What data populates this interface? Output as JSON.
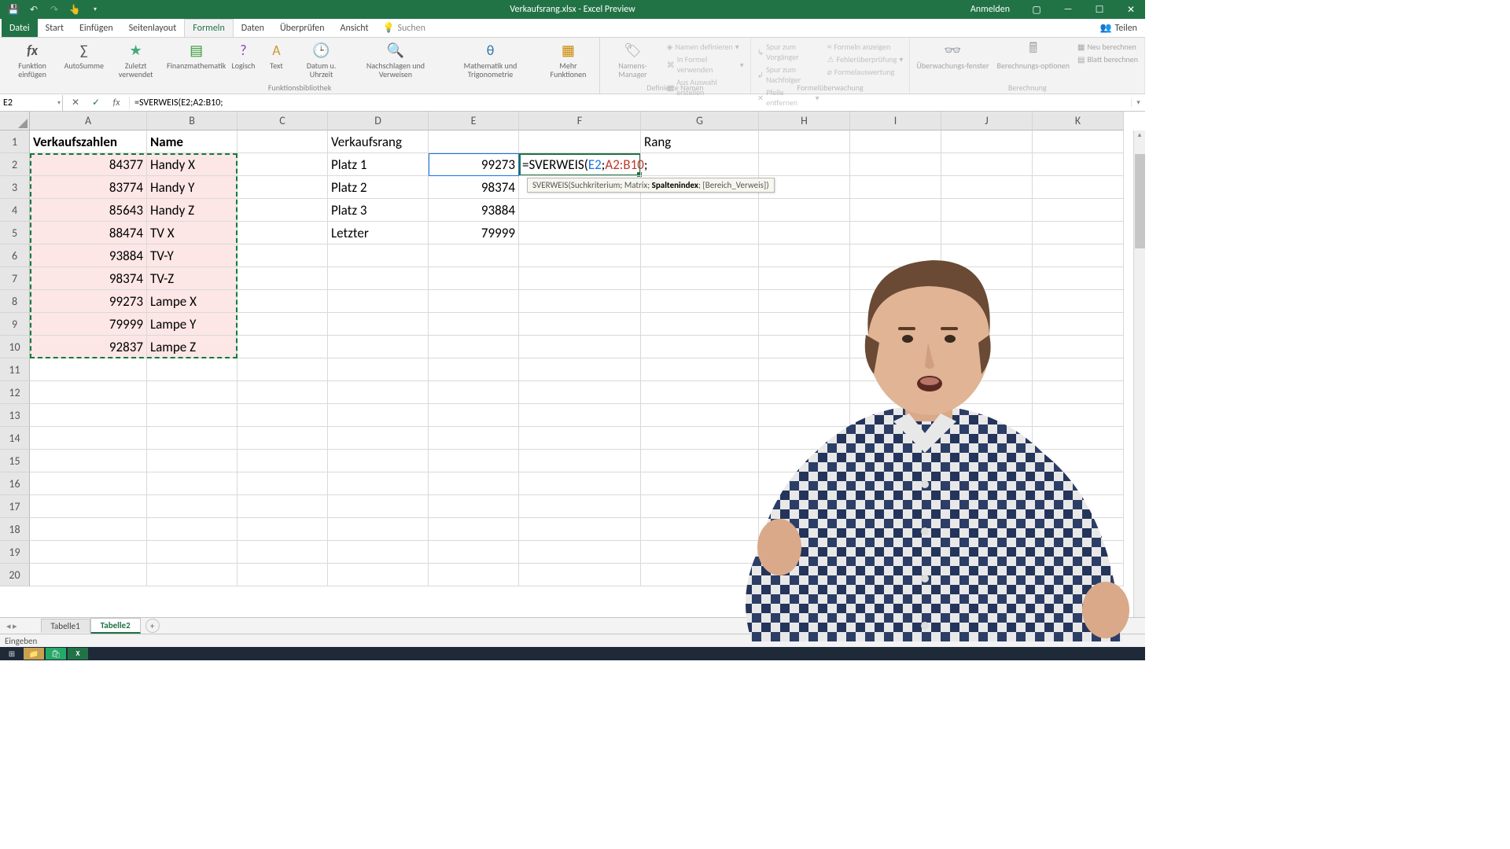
{
  "titlebar": {
    "title": "Verkaufsrang.xlsx - Excel Preview",
    "signin": "Anmelden"
  },
  "tabs": {
    "file": "Datei",
    "start": "Start",
    "einfuegen": "Einfügen",
    "seitenlayout": "Seitenlayout",
    "formeln": "Formeln",
    "daten": "Daten",
    "ueberpruefen": "Überprüfen",
    "ansicht": "Ansicht",
    "suchen": "Suchen",
    "teilen": "Teilen"
  },
  "ribbon": {
    "funktion": "Funktion einfügen",
    "autosumme": "AutoSumme",
    "zuletzt": "Zuletzt verwendet",
    "finanz": "Finanzmathematik",
    "logisch": "Logisch",
    "text": "Text",
    "datum": "Datum u. Uhrzeit",
    "nachschlagen": "Nachschlagen und Verweisen",
    "mathematik": "Mathematik und Trigonometrie",
    "mehr": "Mehr Funktionen",
    "g_bib": "Funktionsbibliothek",
    "namen_mgr": "Namens-Manager",
    "namen_def": "Namen definieren",
    "in_formel": "In Formel verwenden",
    "aus_auswahl": "Aus Auswahl erstellen",
    "g_namen": "Definierte Namen",
    "spur_vor": "Spur zum Vorgänger",
    "spur_nach": "Spur zum Nachfolger",
    "pfeile": "Pfeile entfernen",
    "formeln_anz": "Formeln anzeigen",
    "fehler": "Fehlerüberprüfung",
    "auswertung": "Formelauswertung",
    "g_ueber": "Formelüberwachung",
    "ueberwachung": "Überwachungs-fenster",
    "berechnung": "Berechnungs-optionen",
    "neu": "Neu berechnen",
    "blatt": "Blatt berechnen",
    "g_ber": "Berechnung"
  },
  "formula": {
    "namebox": "E2",
    "value": "=SVERWEIS(E2;A2:B10;"
  },
  "tooltip": {
    "fn": "SVERWEIS",
    "p1": "Suchkriterium",
    "p2": "Matrix",
    "p3": "Spaltenindex",
    "p4": "[Bereich_Verweis]"
  },
  "headers": {
    "A": "Verkaufszahlen",
    "B": "Name",
    "D": "Verkaufsrang",
    "G": "Rang"
  },
  "colA": [
    "84377",
    "83774",
    "85643",
    "88474",
    "93884",
    "98374",
    "99273",
    "79999",
    "92837"
  ],
  "colB": [
    "Handy X",
    "Handy Y",
    "Handy Z",
    "TV X",
    "TV-Y",
    "TV-Z",
    "Lampe X",
    "Lampe Y",
    "Lampe Z"
  ],
  "colD": [
    "Platz 1",
    "Platz 2",
    "Platz 3",
    "Letzter"
  ],
  "colE": [
    "99273",
    "98374",
    "93884",
    "79999"
  ],
  "cellF2": {
    "eq": "=",
    "fn": "SVERWEIS",
    "lp": "(",
    "e2": "E2",
    "s1": ";",
    "rg": "A2:B10",
    "s2": ";"
  },
  "sheets": {
    "s1": "Tabelle1",
    "s2": "Tabelle2"
  },
  "status": "Eingeben",
  "cols": [
    "A",
    "B",
    "C",
    "D",
    "E",
    "F",
    "G",
    "H",
    "I",
    "J",
    "K"
  ]
}
